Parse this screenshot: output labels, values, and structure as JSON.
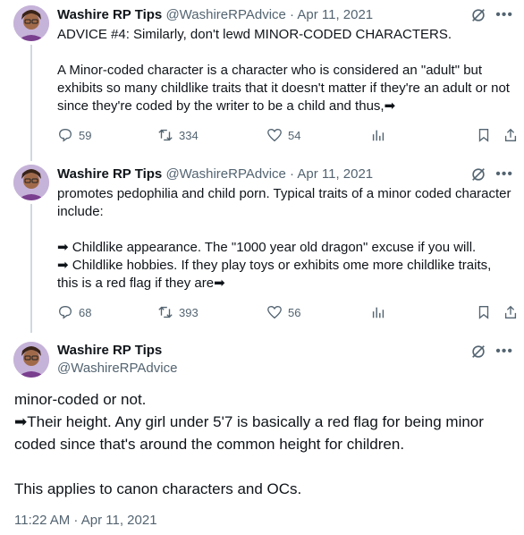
{
  "tweets": [
    {
      "name": "Washire RP Tips",
      "handle_date": "@WashireRPAdvice · Apr 11, 2021",
      "text": "ADVICE #4: Similarly, don't lewd MINOR-CODED CHARACTERS.\n\nA Minor-coded character is a character who is considered an \"adult\" but exhibits so many childlike traits that it doesn't matter if they're an adult or not since they're coded by the writer to be a child and thus,➡",
      "replies": "59",
      "retweets": "334",
      "likes": "54"
    },
    {
      "name": "Washire RP Tips",
      "handle_date": "@WashireRPAdvice · Apr 11, 2021",
      "text": "promotes pedophilia and child porn. Typical traits of a minor coded character include:\n\n➡ Childlike appearance. The \"1000 year old dragon\" excuse if you will.\n➡ Childlike hobbies. If they play toys or exhibits ome more childlike traits, this is a red flag if they are➡",
      "replies": "68",
      "retweets": "393",
      "likes": "56"
    }
  ],
  "main": {
    "name": "Washire RP Tips",
    "handle": "@WashireRPAdvice",
    "text": "minor-coded or not.\n➡Their height. Any girl under 5'7 is basically a red flag for being minor coded since that's around the common height for children.\n\nThis applies to canon characters and OCs.",
    "timestamp": "11:22 AM · Apr 11, 2021"
  },
  "colors": {
    "text": "#0f1419",
    "secondary": "#536471",
    "line": "#cfd9de"
  },
  "icons": [
    "grok-icon",
    "more-icon",
    "reply-icon",
    "retweet-icon",
    "like-icon",
    "views-icon",
    "bookmark-icon",
    "share-icon"
  ]
}
